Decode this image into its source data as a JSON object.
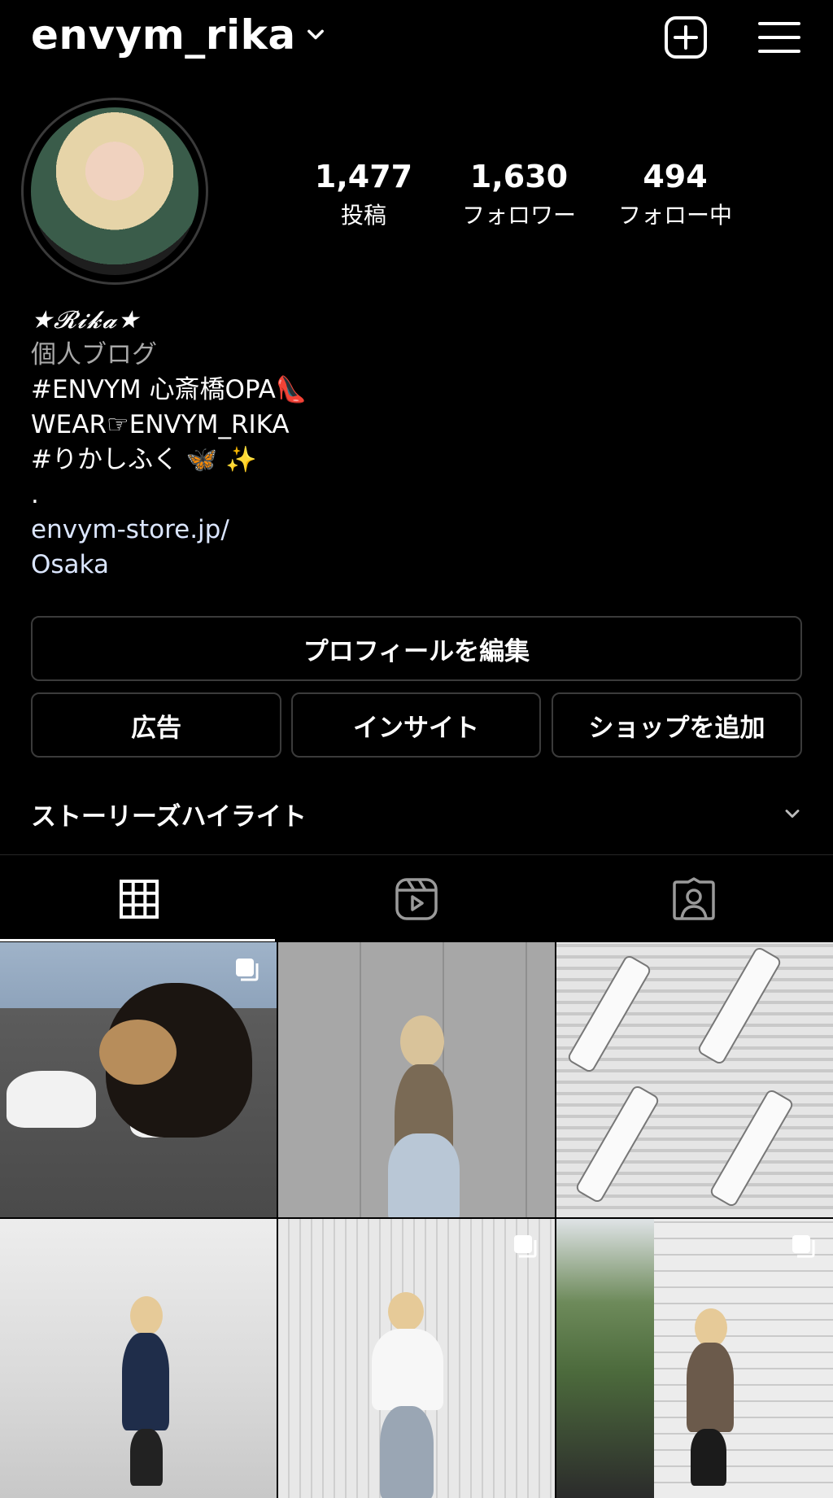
{
  "header": {
    "username": "envym_rika"
  },
  "profile": {
    "stats": [
      {
        "value": "1,477",
        "label": "投稿"
      },
      {
        "value": "1,630",
        "label": "フォロワー"
      },
      {
        "value": "494",
        "label": "フォロー中"
      }
    ],
    "bio": {
      "name": "★𝓡𝓲𝓴𝓪★",
      "category": "個人ブログ",
      "lines": [
        "#ENVYM 心斎橋OPA👠",
        "WEAR☞ENVYM_RIKA",
        "#りかしふく 🦋 ✨",
        "."
      ],
      "website": "envym-store.jp/",
      "location": "Osaka"
    }
  },
  "buttons": {
    "edit_profile": "プロフィールを編集",
    "ads": "広告",
    "insights": "インサイト",
    "add_shop": "ショップを追加"
  },
  "highlights": {
    "label": "ストーリーズハイライト"
  },
  "tabs": [
    {
      "icon": "grid-icon",
      "active": true
    },
    {
      "icon": "reels-icon",
      "active": false
    },
    {
      "icon": "tagged-icon",
      "active": false
    }
  ],
  "posts": [
    {
      "multi": true
    },
    {
      "multi": false
    },
    {
      "multi": false
    },
    {
      "multi": false
    },
    {
      "multi": true
    },
    {
      "multi": true
    }
  ]
}
